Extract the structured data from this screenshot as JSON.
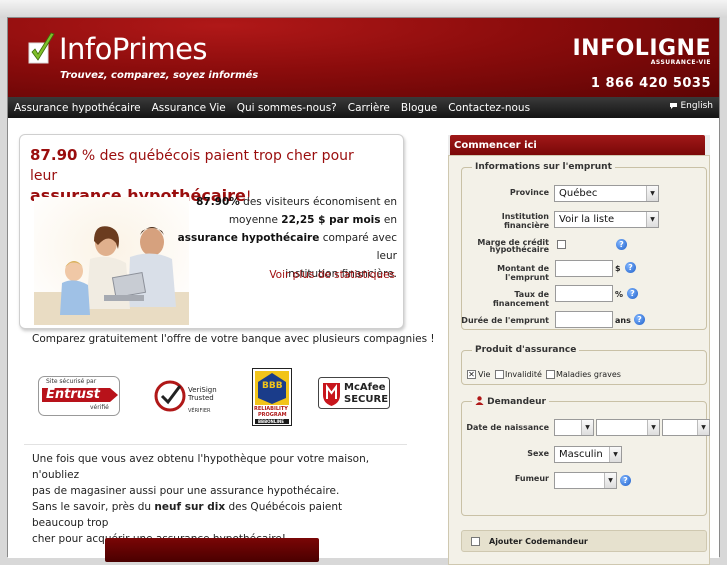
{
  "header": {
    "brand": "InfoPrimes",
    "tagline": "Trouvez, comparez, soyez informés",
    "partner_name": "INFOLIGNE",
    "partner_sub": "ASSURANCE-VIE",
    "partner_phone": "1 866 420 5035"
  },
  "nav": {
    "items": [
      "Assurance hypothécaire",
      "Assurance Vie",
      "Qui sommes-nous?",
      "Carrière",
      "Blogue",
      "Contactez-nous"
    ],
    "language": "English"
  },
  "promo": {
    "percent": "87.90",
    "headline_rest": " % des québécois paient trop cher pour leur",
    "headline_big": "assurance hypothécaire",
    "headline_end": "!",
    "stat_pct": "87.90%",
    "stat_line1": " des visiteurs économisent en",
    "stat_line2_pre": "moyenne ",
    "stat_amount": "22,25 $ par mois",
    "stat_line2_post": " en",
    "stat_bold": "assurance hypothécaire",
    "stat_line3_post": " comparé avec leur",
    "stat_line4": "institution financière.",
    "link": "Voir plus de statistiques"
  },
  "compare_text": "Comparez gratuitement l'offre de votre banque avec plusieurs compagnies !",
  "badges": {
    "entrust_top": "Site sécurisé par",
    "entrust_name": "Entrust",
    "entrust_sub": "vérifié",
    "verisign_line1": "VeriSign",
    "verisign_line2": "Trusted",
    "verisign_sub": "VÉRIFIER",
    "bbb": "BBB",
    "bbb_sub1": "RELIABILITY",
    "bbb_sub2": "PROGRAM",
    "bbb_sub3": "BBBONLINE",
    "mcafee_line1": "McAfee",
    "mcafee_line2": "SECURE"
  },
  "bottom": {
    "line1": "Une fois que vous avez obtenu l'hypothèque pour votre maison, n'oubliez",
    "line2": "pas de magasiner aussi pour une assurance hypothécaire.",
    "line3": "Sans le savoir, près du ",
    "line3_bold": "neuf sur dix",
    "line3_end": " des Québécois paient beaucoup trop",
    "line4": "cher pour acquérir une assurance hypothécaire!"
  },
  "sidebar": {
    "title": "Commencer ici",
    "loan_legend": "Informations sur l'emprunt",
    "province_label": "Province",
    "province_value": "Québec",
    "institution_label": "Institution financière",
    "institution_value": "Voir la liste",
    "credit_label1": "Marge de crédit",
    "credit_label2": "hypothécaire",
    "amount_label": "Montant de l'emprunt",
    "amount_unit": "$",
    "rate_label": "Taux de financement",
    "rate_unit": "%",
    "duration_label": "Durée de l'emprunt",
    "duration_unit": "ans",
    "product_legend": "Produit d'assurance",
    "product_vie": "Vie",
    "product_invalidite": "Invalidité",
    "product_maladies": "Maladies graves",
    "applicant_legend": "Demandeur",
    "birth_label": "Date de naissance",
    "sex_label": "Sexe",
    "sex_value": "Masculin",
    "smoker_label": "Fumeur",
    "cosign_label": "Ajouter Codemandeur"
  },
  "colors": {
    "brand_red": "#8b0c0c",
    "link_red": "#a01010",
    "nav_bg": "#1e1e1e"
  }
}
